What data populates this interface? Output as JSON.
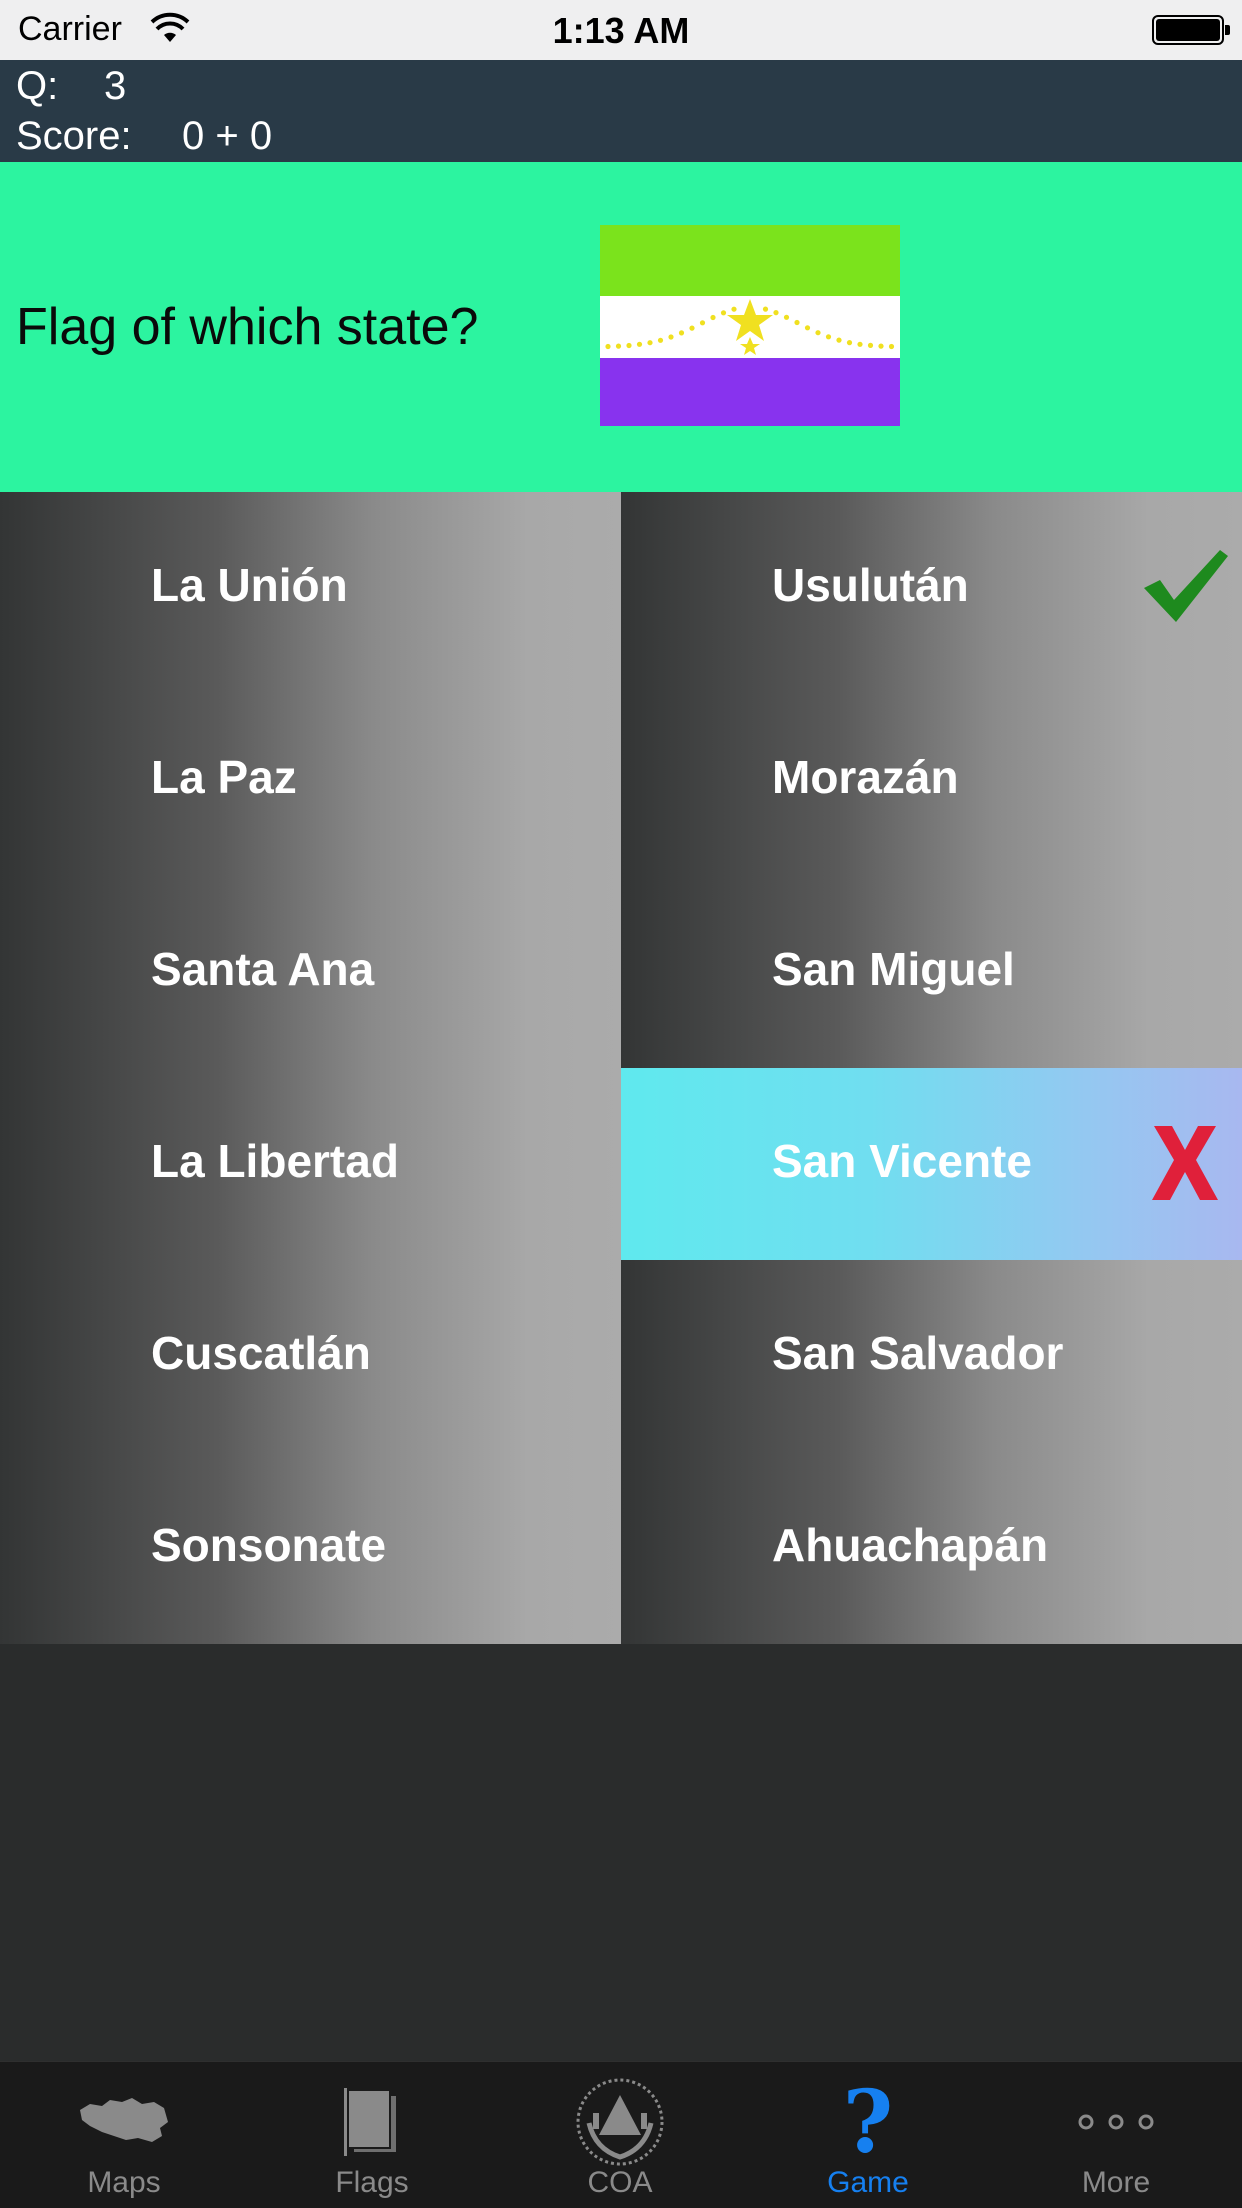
{
  "status_bar": {
    "carrier": "Carrier",
    "time": "1:13 AM",
    "battery_level": 1.0
  },
  "info": {
    "q_label": "Q:",
    "q_value": "3",
    "score_label": "Score:",
    "score_value": "0 + 0"
  },
  "question": {
    "text": "Flag of which state?",
    "flag_icon": "usulutan-flag-image"
  },
  "answers": {
    "left": [
      "La Unión",
      "La Paz",
      "Santa Ana",
      "La Libertad",
      "Cuscatlán",
      "Sonsonate"
    ],
    "right": [
      "Usulután",
      "Morazán",
      "San Miguel",
      "San Vicente",
      "San Salvador",
      "Ahuachapán"
    ],
    "correct": "Usulután",
    "selected_wrong": "San Vicente"
  },
  "colors": {
    "question_bg": "#2cf4a0",
    "info_bar_bg": "#293a47",
    "correct_mark": "#1e8a1e",
    "wrong_mark": "#e0203a",
    "tab_active": "#1680f0",
    "tab_inactive": "#8a8a8a"
  },
  "tabbar": {
    "tabs": [
      {
        "label": "Maps",
        "icon": "map-icon",
        "active": false
      },
      {
        "label": "Flags",
        "icon": "flags-icon",
        "active": false
      },
      {
        "label": "COA",
        "icon": "coat-of-arms-icon",
        "active": false
      },
      {
        "label": "Game",
        "icon": "question-mark-icon",
        "active": true
      },
      {
        "label": "More",
        "icon": "more-dots-icon",
        "active": false
      }
    ]
  }
}
